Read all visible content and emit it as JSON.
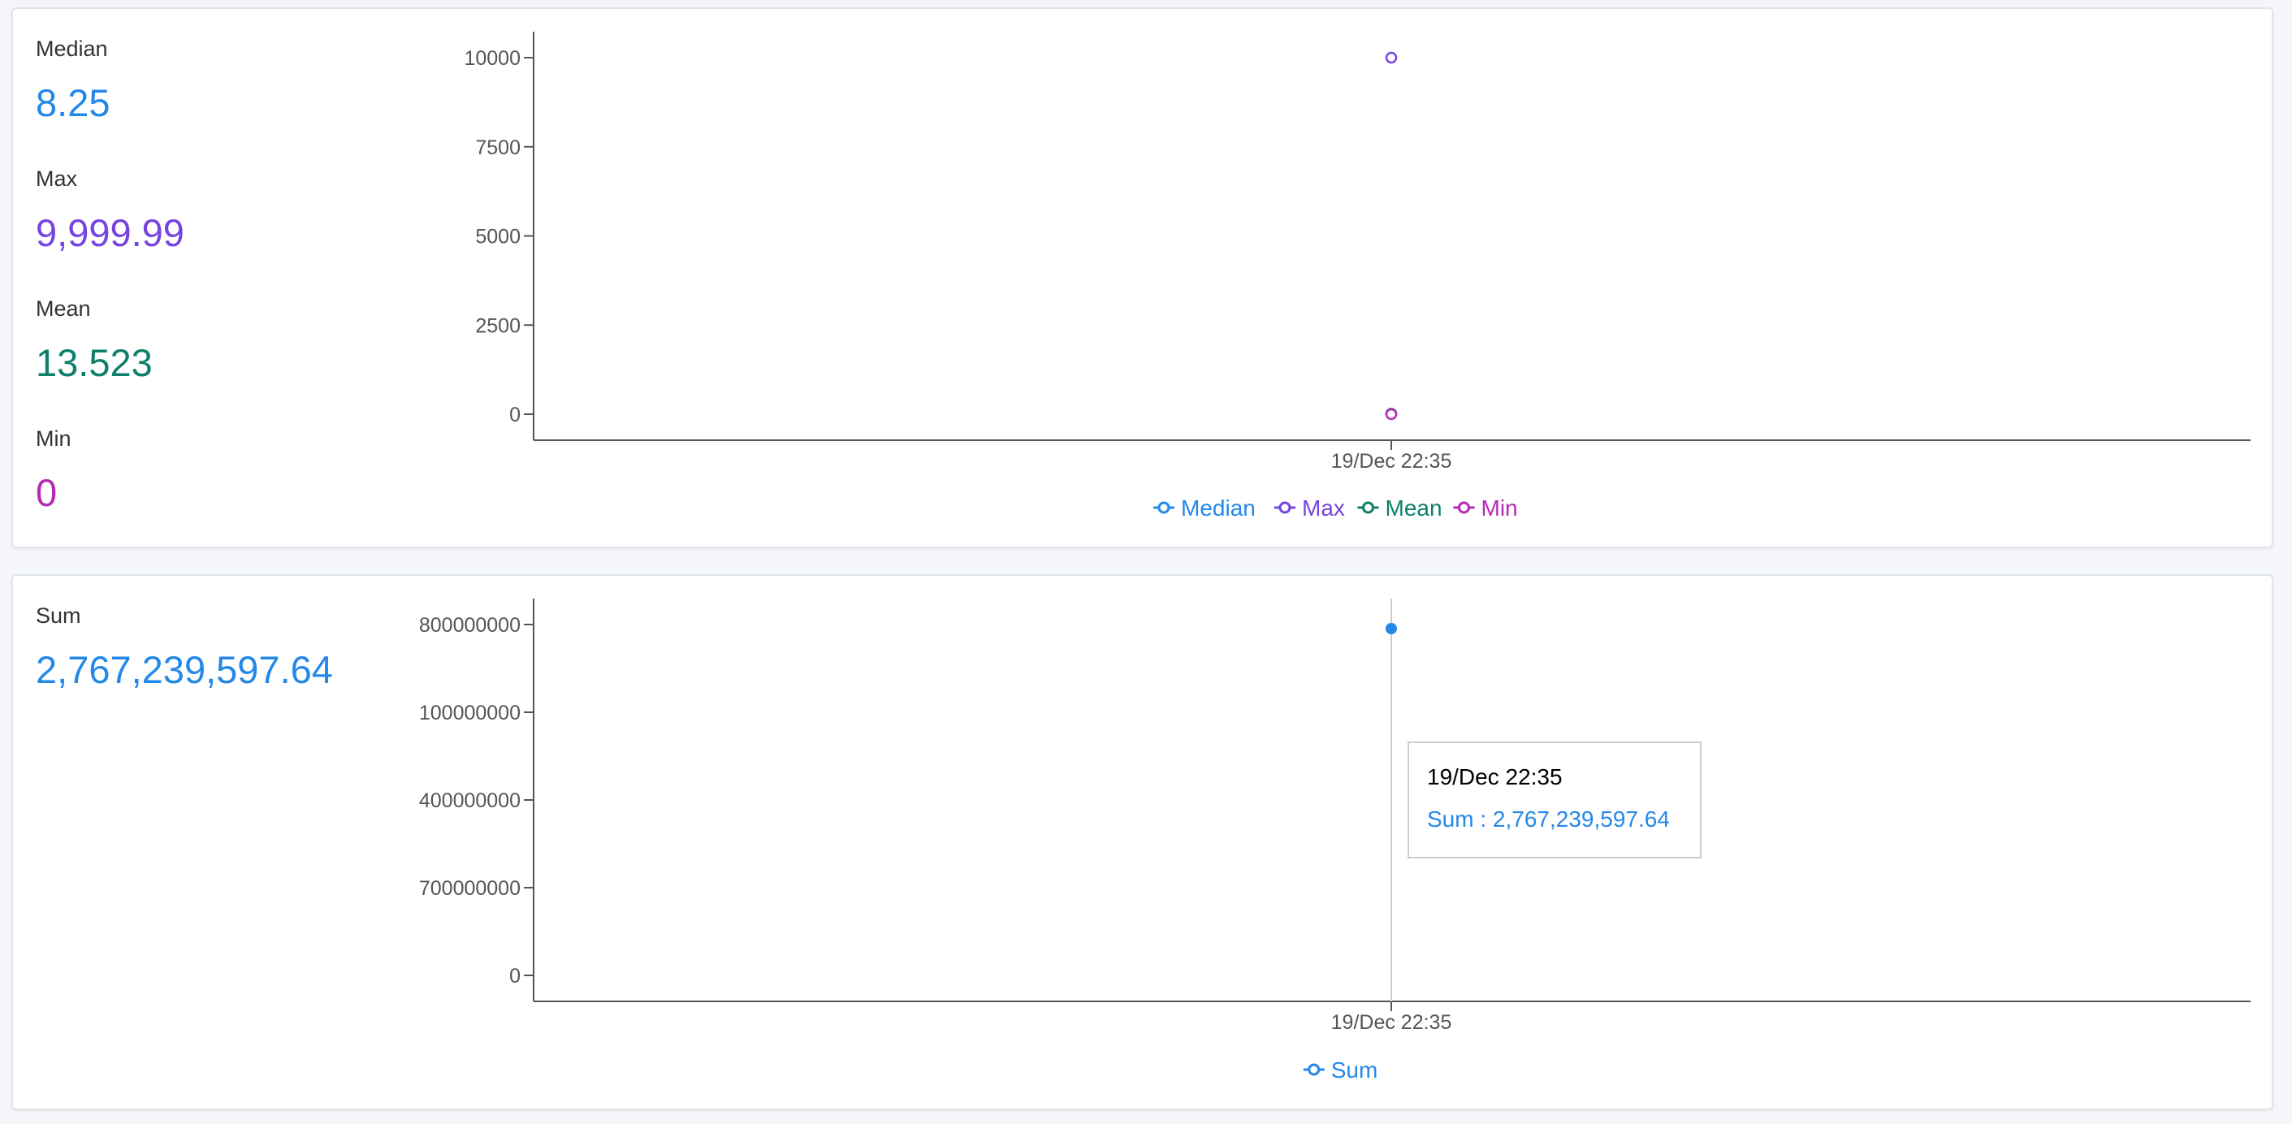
{
  "colors": {
    "median": "#2488e8",
    "max": "#7644e0",
    "mean": "#0d7f6a",
    "min": "#b52ab2",
    "sum": "#2488e8",
    "axis": "#555555",
    "tick_text": "#555555"
  },
  "panel1": {
    "stats": [
      {
        "label": "Median",
        "value": "8.25"
      },
      {
        "label": "Max",
        "value": "9,999.99"
      },
      {
        "label": "Mean",
        "value": "13.523"
      },
      {
        "label": "Min",
        "value": "0"
      }
    ]
  },
  "panel2": {
    "stats": [
      {
        "label": "Sum",
        "value": "2,767,239,597.64"
      }
    ],
    "tooltip": {
      "title": "19/Dec 22:35",
      "row": "Sum : 2,767,239,597.64"
    }
  },
  "chart_data": [
    {
      "type": "scatter",
      "x": [
        "19/Dec 22:35"
      ],
      "x_tick_labels": [
        "19/Dec 22:35"
      ],
      "y_tick_labels": [
        "10000",
        "7500",
        "5000",
        "2500",
        "0"
      ],
      "series": [
        {
          "name": "Median",
          "values": [
            8.25
          ]
        },
        {
          "name": "Max",
          "values": [
            9999.99
          ]
        },
        {
          "name": "Mean",
          "values": [
            13.523
          ]
        },
        {
          "name": "Min",
          "values": [
            0
          ]
        }
      ],
      "ylim": [
        0,
        10000
      ],
      "legend": "bottom-center"
    },
    {
      "type": "scatter",
      "x": [
        "19/Dec 22:35"
      ],
      "x_tick_labels": [
        "19/Dec 22:35"
      ],
      "y_tick_labels": [
        "800000000",
        "100000000",
        "400000000",
        "700000000",
        "0"
      ],
      "series": [
        {
          "name": "Sum",
          "values": [
            2767239597.64
          ]
        }
      ],
      "legend": "bottom-center"
    }
  ]
}
